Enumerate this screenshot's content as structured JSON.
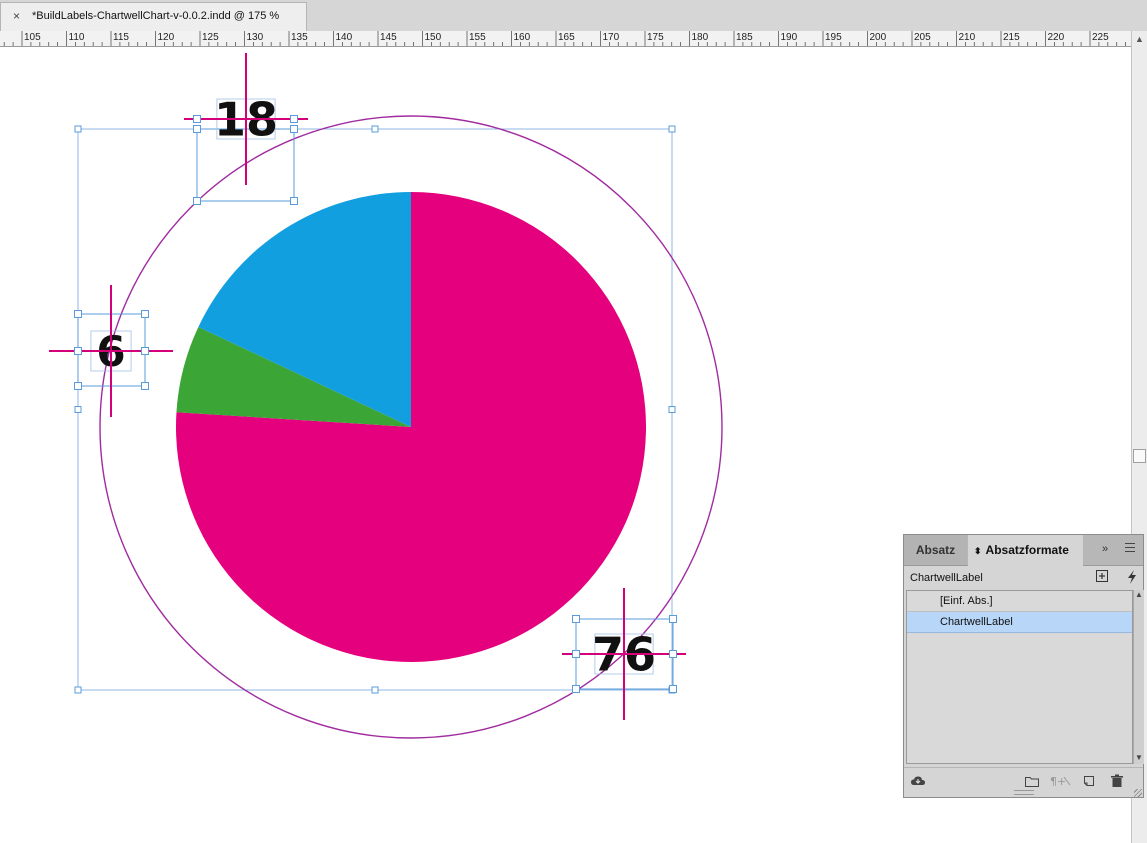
{
  "document_tab": {
    "close_glyph": "×",
    "title": "*BuildLabels-ChartwellChart-v-0.0.2.indd @ 175 %"
  },
  "ruler": {
    "labels": [
      "105",
      "110",
      "115",
      "120",
      "125",
      "130",
      "135",
      "140",
      "145",
      "150",
      "155",
      "160",
      "165",
      "170",
      "175",
      "180",
      "185",
      "190",
      "195",
      "200",
      "205",
      "210",
      "215",
      "220",
      "225"
    ]
  },
  "chart_data": {
    "type": "pie",
    "categories": [
      "76",
      "6",
      "18"
    ],
    "values": [
      76,
      6,
      18
    ],
    "colors": [
      "#e5007d",
      "#3ba535",
      "#129fe0"
    ],
    "labels": [
      "18",
      "6",
      "76"
    ],
    "start_angle": "12 o'clock, clockwise"
  },
  "panel": {
    "tabs": {
      "absatz": "Absatz",
      "absatzformate": "Absatzformate",
      "updown_glyph": "⬍"
    },
    "collapse_glyph": "»",
    "current_style": "ChartwellLabel",
    "styles": [
      "[Einf. Abs.]",
      "ChartwellLabel"
    ],
    "selected_style": "ChartwellLabel"
  },
  "colors": {
    "accent_magenta": "#e5007d",
    "frame_blue": "#5b9bdb",
    "circle_purple": "#a02ca0",
    "selection_blue": "#b7d6f8"
  }
}
